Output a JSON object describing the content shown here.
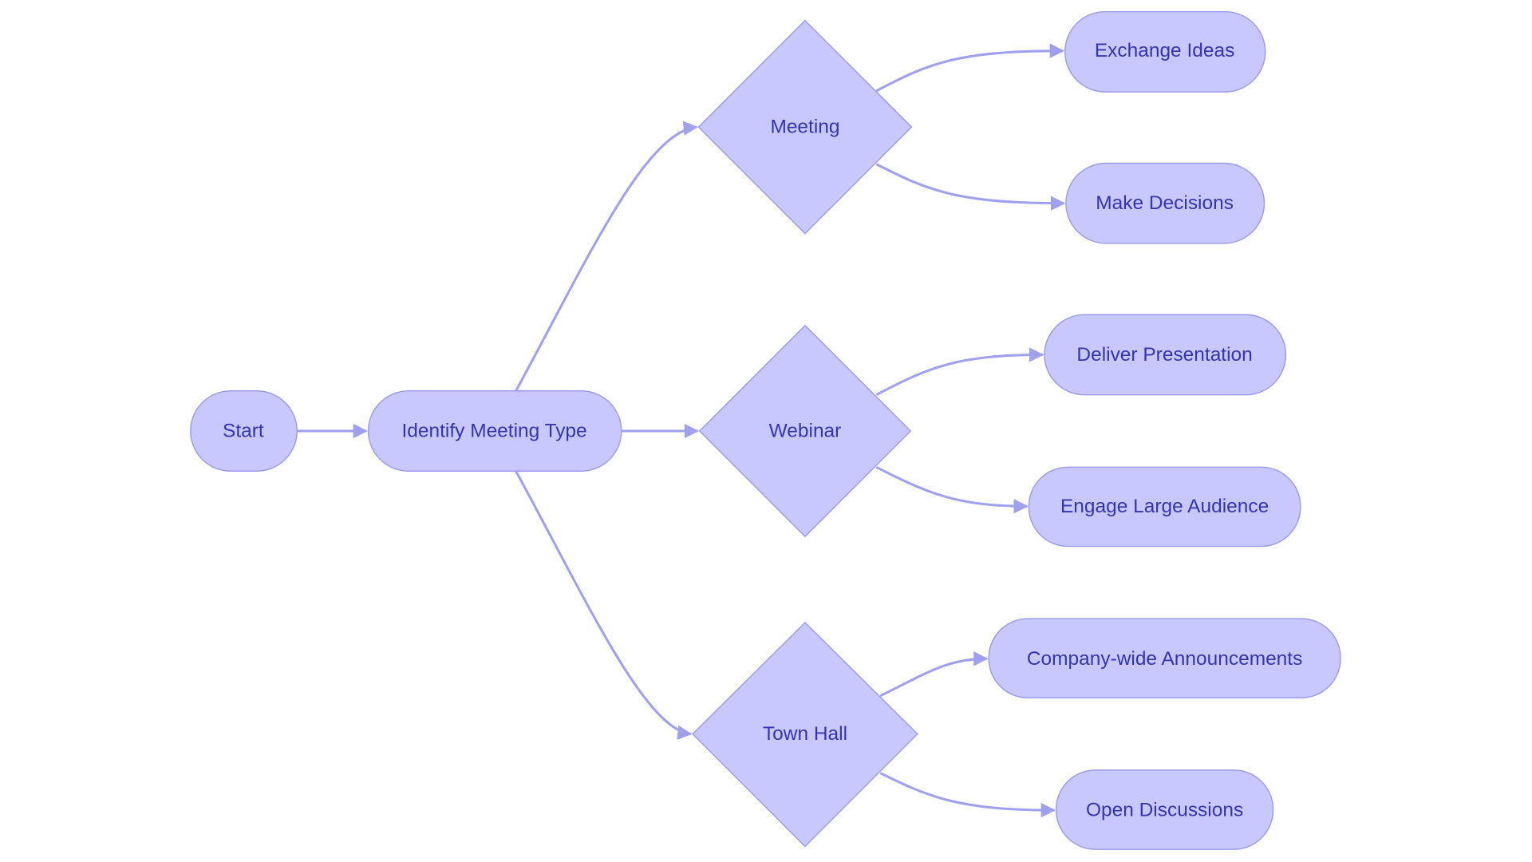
{
  "diagram": {
    "type": "flowchart",
    "direction": "left-to-right",
    "colors": {
      "node_fill": "#c8c8ff",
      "node_stroke": "#9c9cec",
      "edge": "#a0a0ee",
      "text": "#3434b4"
    },
    "nodes": {
      "start": {
        "label": "Start",
        "shape": "rounded"
      },
      "identify": {
        "label": "Identify Meeting Type",
        "shape": "rounded"
      },
      "meeting": {
        "label": "Meeting",
        "shape": "diamond"
      },
      "webinar": {
        "label": "Webinar",
        "shape": "diamond"
      },
      "townhall": {
        "label": "Town Hall",
        "shape": "diamond"
      },
      "exchange": {
        "label": "Exchange Ideas",
        "shape": "rounded"
      },
      "decisions": {
        "label": "Make Decisions",
        "shape": "rounded"
      },
      "deliver": {
        "label": "Deliver Presentation",
        "shape": "rounded"
      },
      "engage": {
        "label": "Engage Large Audience",
        "shape": "rounded"
      },
      "announce": {
        "label": "Company-wide Announcements",
        "shape": "rounded"
      },
      "open": {
        "label": "Open Discussions",
        "shape": "rounded"
      }
    },
    "edges": [
      [
        "start",
        "identify"
      ],
      [
        "identify",
        "meeting"
      ],
      [
        "identify",
        "webinar"
      ],
      [
        "identify",
        "townhall"
      ],
      [
        "meeting",
        "exchange"
      ],
      [
        "meeting",
        "decisions"
      ],
      [
        "webinar",
        "deliver"
      ],
      [
        "webinar",
        "engage"
      ],
      [
        "townhall",
        "announce"
      ],
      [
        "townhall",
        "open"
      ]
    ]
  }
}
